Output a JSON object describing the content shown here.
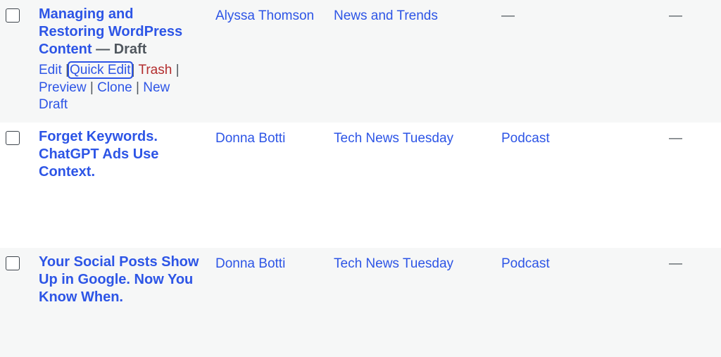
{
  "rows": [
    {
      "title": "Managing and Restoring WordPress Content",
      "state": "Draft",
      "state_sep": " — ",
      "actions": {
        "edit": "Edit",
        "quick_edit": "Quick Edit",
        "trash": "Trash",
        "preview": "Preview",
        "clone": "Clone",
        "new_draft": "New Draft",
        "separator": "|"
      },
      "author": "Alyssa Thomson",
      "category": "News and Trends",
      "tags": "—",
      "extra": "—"
    },
    {
      "title": "Forget Keywords. ChatGPT Ads Use Context.",
      "author": "Donna Botti",
      "category": "Tech News Tuesday",
      "tags": "Podcast",
      "extra": "—"
    },
    {
      "title": "Your Social Posts Show Up in Google. Now You Know When.",
      "author": "Donna Botti",
      "category": "Tech News Tuesday",
      "tags": "Podcast",
      "extra": "—"
    }
  ],
  "colors": {
    "link": "#2d55e6",
    "trash": "#b32d2e",
    "text_muted": "#50575e",
    "row_alt": "#f6f7f7",
    "row": "#ffffff"
  }
}
